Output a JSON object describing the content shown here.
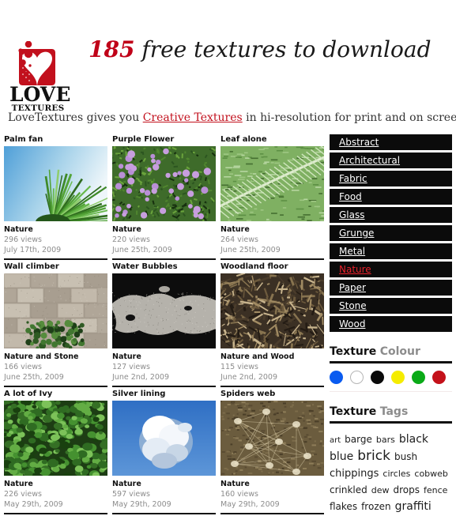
{
  "site": {
    "logo_love": "LOVE",
    "logo_textures": "TEXTURES",
    "logo_icon": "heart-bubbles-logo",
    "headline_count": "185",
    "headline_rest": " free textures to download",
    "tagline_before": "LoveTextures gives you ",
    "tagline_link": "Creative Textures",
    "tagline_after": " in hi-resolution for print and on screen."
  },
  "textures": [
    {
      "title": "Palm fan",
      "category": "Nature",
      "views": "296 views",
      "date": "July 17th, 2009",
      "image": "palm-fan-thumbnail"
    },
    {
      "title": "Purple Flower",
      "category": "Nature",
      "views": "220 views",
      "date": "June 25th, 2009",
      "image": "purple-flower-thumbnail"
    },
    {
      "title": "Leaf alone",
      "category": "Nature",
      "views": "264 views",
      "date": "June 25th, 2009",
      "image": "leaf-alone-thumbnail"
    },
    {
      "title": "Wall climber",
      "category": "Nature and Stone",
      "views": "166 views",
      "date": "June 25th, 2009",
      "image": "wall-climber-thumbnail"
    },
    {
      "title": "Water Bubbles",
      "category": "Nature",
      "views": "127 views",
      "date": "June 2nd, 2009",
      "image": "water-bubbles-thumbnail"
    },
    {
      "title": "Woodland floor",
      "category": "Nature and Wood",
      "views": "115 views",
      "date": "June 2nd, 2009",
      "image": "woodland-floor-thumbnail"
    },
    {
      "title": "A lot of Ivy",
      "category": "Nature",
      "views": "226 views",
      "date": "May 29th, 2009",
      "image": "a-lot-of-ivy-thumbnail"
    },
    {
      "title": "Silver lining",
      "category": "Nature",
      "views": "597 views",
      "date": "May 29th, 2009",
      "image": "silver-lining-thumbnail"
    },
    {
      "title": "Spiders web",
      "category": "Nature",
      "views": "160 views",
      "date": "May 29th, 2009",
      "image": "spiders-web-thumbnail"
    }
  ],
  "categories": [
    {
      "label": "Abstract",
      "active": false
    },
    {
      "label": "Architectural",
      "active": false
    },
    {
      "label": "Fabric",
      "active": false
    },
    {
      "label": "Food",
      "active": false
    },
    {
      "label": "Glass",
      "active": false
    },
    {
      "label": "Grunge",
      "active": false
    },
    {
      "label": "Metal",
      "active": false
    },
    {
      "label": "Nature",
      "active": true
    },
    {
      "label": "Paper",
      "active": false
    },
    {
      "label": "Stone",
      "active": false
    },
    {
      "label": "Wood",
      "active": false
    }
  ],
  "colour_section": {
    "heading_strong": "Texture",
    "heading_light": "Colour",
    "swatches": [
      {
        "name": "blue",
        "hex": "#0a5bf0"
      },
      {
        "name": "white",
        "hex": "#ffffff"
      },
      {
        "name": "black",
        "hex": "#0a0a0a"
      },
      {
        "name": "yellow",
        "hex": "#f5ec00"
      },
      {
        "name": "green",
        "hex": "#0aaa17"
      },
      {
        "name": "red",
        "hex": "#c4111a"
      }
    ]
  },
  "tags_section": {
    "heading_strong": "Texture",
    "heading_light": "Tags",
    "tags": [
      {
        "label": "art",
        "size": 10
      },
      {
        "label": "barge",
        "size": 12
      },
      {
        "label": "bars",
        "size": 11
      },
      {
        "label": "black",
        "size": 14
      },
      {
        "label": "blue",
        "size": 14
      },
      {
        "label": "brick",
        "size": 17
      },
      {
        "label": "bush",
        "size": 12
      },
      {
        "label": "chippings",
        "size": 13
      },
      {
        "label": "circles",
        "size": 11
      },
      {
        "label": "cobweb",
        "size": 11
      },
      {
        "label": "crinkled",
        "size": 12
      },
      {
        "label": "dew",
        "size": 11
      },
      {
        "label": "drops",
        "size": 12
      },
      {
        "label": "fence",
        "size": 11
      },
      {
        "label": "flakes",
        "size": 12
      },
      {
        "label": "frozen",
        "size": 12
      },
      {
        "label": "graffiti",
        "size": 14
      }
    ]
  }
}
